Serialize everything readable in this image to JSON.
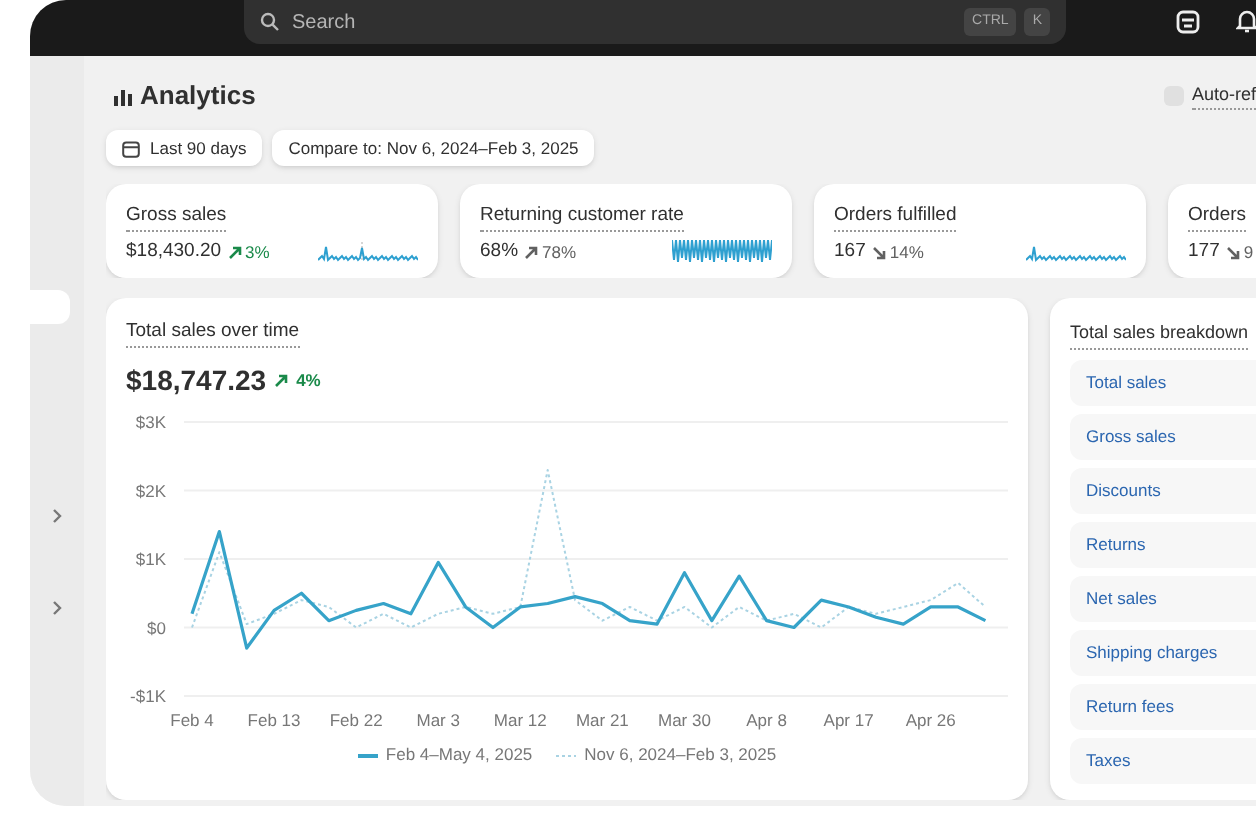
{
  "top_bar": {
    "search": {
      "placeholder": "Search",
      "shortcut": [
        "CTRL",
        "K"
      ]
    }
  },
  "page": {
    "title": "Analytics",
    "auto_refresh": {
      "label": "Auto-ref",
      "checked": false
    }
  },
  "filters": [
    {
      "label": "Last 90 days",
      "kind": "date"
    },
    {
      "label": "Compare to: Nov 6, 2024–Feb 3, 2025",
      "kind": "plain"
    }
  ],
  "metrics": [
    {
      "label": "Gross sales",
      "value": "$18,430.20",
      "change": "3%",
      "increase": true,
      "positive": true
    },
    {
      "label": "Returning customer rate",
      "value": "68%",
      "change": "78%",
      "increase": true,
      "positive": false
    },
    {
      "label": "Orders fulfilled",
      "value": "167",
      "change": "14%",
      "increase": false,
      "positive": false
    },
    {
      "label": "Orders",
      "value": "177",
      "change": "9",
      "increase": false,
      "positive": false
    }
  ],
  "sales_chart": {
    "title": "Total sales over time",
    "total": "$18,747.23",
    "change": "4%",
    "increase": true,
    "positive": true,
    "chart_data": {
      "type": "line",
      "grid": true,
      "categories": [
        "Feb 4",
        null,
        null,
        "Feb 13",
        null,
        null,
        "Feb 22",
        null,
        null,
        "Mar 3",
        null,
        null,
        "Mar 12",
        null,
        null,
        "Mar 21",
        null,
        null,
        "Mar 30",
        null,
        null,
        "Apr 8",
        null,
        null,
        "Apr 17",
        null,
        null,
        "Apr 26",
        null,
        null
      ],
      "series": [
        {
          "name": "Feb 4–May 4, 2025",
          "color": "#36a3c9",
          "line_style": "solid",
          "values": [
            0.2,
            1.4,
            -0.3,
            0.25,
            0.5,
            0.1,
            0.25,
            0.35,
            0.2,
            0.95,
            0.3,
            0.0,
            0.3,
            0.35,
            0.45,
            0.35,
            0.1,
            0.05,
            0.8,
            0.1,
            0.75,
            0.1,
            0.0,
            0.4,
            0.3,
            0.15,
            0.05,
            0.3,
            0.3,
            0.1
          ]
        },
        {
          "name": "Nov 6, 2024–Feb 3, 2025",
          "color": "#a9d3e3",
          "line_style": "dashed",
          "values": [
            0.0,
            1.1,
            0.05,
            0.2,
            0.4,
            0.3,
            0.0,
            0.2,
            0.0,
            0.2,
            0.3,
            0.2,
            0.3,
            2.3,
            0.4,
            0.1,
            0.3,
            0.1,
            0.3,
            0.0,
            0.3,
            0.1,
            0.2,
            0.0,
            0.3,
            0.2,
            0.3,
            0.4,
            0.65,
            0.3
          ]
        }
      ],
      "ylim": [
        -1,
        3
      ],
      "yticks": [
        {
          "value": 3,
          "label": "$3K"
        },
        {
          "value": 2,
          "label": "$2K"
        },
        {
          "value": 1,
          "label": "$1K"
        },
        {
          "value": 0,
          "label": "$0"
        },
        {
          "value": -1,
          "label": "-$1K"
        }
      ]
    }
  },
  "breakdown": {
    "title": "Total sales breakdown",
    "items": [
      "Total sales",
      "Gross sales",
      "Discounts",
      "Returns",
      "Net sales",
      "Shipping charges",
      "Return fees",
      "Taxes"
    ]
  }
}
